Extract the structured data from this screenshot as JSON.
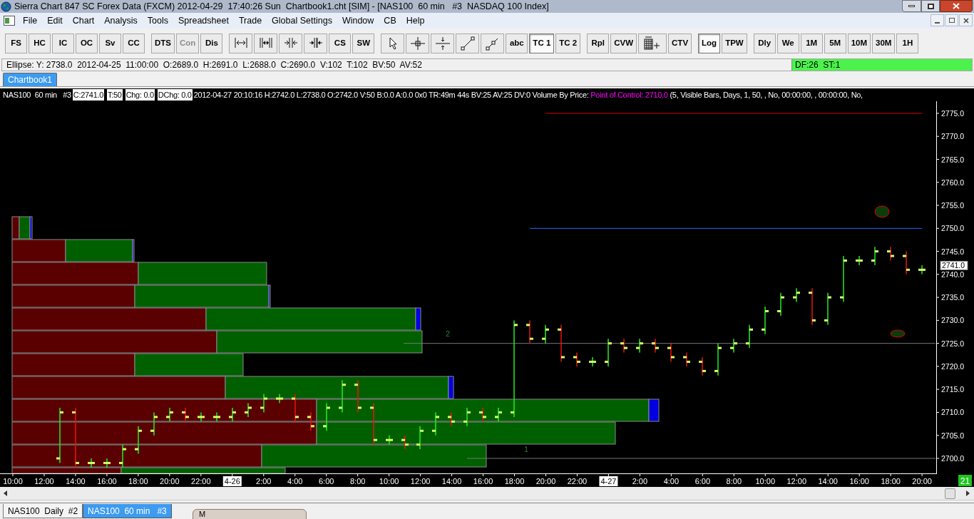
{
  "window": {
    "title": "Sierra Chart 847 SC Forex Data (FXCM) 2012-04-29  17:40:26 Sun  Chartbook1.cht [SIM] - [NAS100  60 min   #3  NASDAQ 100 Index]"
  },
  "menu": [
    "File",
    "Edit",
    "Chart",
    "Analysis",
    "Tools",
    "Spreadsheet",
    "Trade",
    "Global Settings",
    "Window",
    "CB",
    "Help"
  ],
  "toolbar": [
    [
      {
        "kind": "text",
        "label": "FS",
        "pressed": false,
        "disabled": false
      },
      {
        "kind": "text",
        "label": "HC",
        "pressed": false,
        "disabled": false
      },
      {
        "kind": "text",
        "label": "IC",
        "pressed": false,
        "disabled": false
      },
      {
        "kind": "text",
        "label": "OC",
        "pressed": false,
        "disabled": false
      },
      {
        "kind": "text",
        "label": "Sv",
        "pressed": false,
        "disabled": false
      },
      {
        "kind": "text",
        "label": "CC",
        "pressed": false,
        "disabled": false
      }
    ],
    [
      {
        "kind": "text",
        "label": "DTS",
        "pressed": false,
        "disabled": false
      },
      {
        "kind": "text",
        "label": "Con",
        "pressed": false,
        "disabled": true
      },
      {
        "kind": "text",
        "label": "Dis",
        "pressed": false,
        "disabled": false
      }
    ],
    [
      {
        "kind": "icon",
        "pressed": false,
        "disabled": false
      },
      {
        "kind": "icon",
        "pressed": false,
        "disabled": false
      },
      {
        "kind": "icon",
        "pressed": false,
        "disabled": false
      },
      {
        "kind": "icon",
        "pressed": false,
        "disabled": false
      },
      {
        "kind": "text",
        "label": "CS",
        "pressed": false,
        "disabled": false
      },
      {
        "kind": "text",
        "label": "SW",
        "pressed": false,
        "disabled": false
      }
    ],
    [
      {
        "kind": "icon",
        "pressed": false,
        "disabled": false
      },
      {
        "kind": "icon",
        "pressed": false,
        "disabled": false
      },
      {
        "kind": "icon",
        "pressed": false,
        "disabled": false
      },
      {
        "kind": "icon",
        "pressed": false,
        "disabled": false
      },
      {
        "kind": "icon",
        "pressed": false,
        "disabled": false
      },
      {
        "kind": "text",
        "label": "abc",
        "pressed": false,
        "disabled": false
      },
      {
        "kind": "text",
        "label": "TC 1",
        "pressed": true,
        "disabled": false
      },
      {
        "kind": "text",
        "label": "TC 2",
        "pressed": false,
        "disabled": false
      }
    ],
    [
      {
        "kind": "text",
        "label": "Rpl",
        "pressed": false,
        "disabled": false
      },
      {
        "kind": "text",
        "label": "CVW",
        "pressed": false,
        "disabled": false
      },
      {
        "kind": "icon",
        "pressed": false,
        "disabled": false
      },
      {
        "kind": "text",
        "label": "CTV",
        "pressed": false,
        "disabled": false
      }
    ],
    [
      {
        "kind": "text",
        "label": "Log",
        "pressed": true,
        "disabled": false
      },
      {
        "kind": "text",
        "label": "TPW",
        "pressed": false,
        "disabled": false
      }
    ],
    [
      {
        "kind": "text",
        "label": "Dly",
        "pressed": false,
        "disabled": false
      },
      {
        "kind": "text",
        "label": "We",
        "pressed": false,
        "disabled": false
      },
      {
        "kind": "text",
        "label": "1M",
        "pressed": false,
        "disabled": false
      },
      {
        "kind": "text",
        "label": "5M",
        "pressed": false,
        "disabled": false
      },
      {
        "kind": "text",
        "label": "10M",
        "pressed": false,
        "disabled": false
      },
      {
        "kind": "text",
        "label": "30M",
        "pressed": false,
        "disabled": false
      },
      {
        "kind": "text",
        "label": "1H",
        "pressed": false,
        "disabled": false
      }
    ]
  ],
  "status": {
    "text": "Ellipse: Y: 2738.0  2012-04-25  11:00:00  O:2689.0  H:2691.0  L:2688.0  C:2690.0  V:102  T:102  BV:50  AV:52",
    "feed": "DF:26  ST:1"
  },
  "chartbook_tabs": [
    {
      "label": "Chartbook1",
      "selected": true
    }
  ],
  "chart": {
    "header": [
      {
        "kind": "plain",
        "text": "NAS100  60 min   #3"
      },
      {
        "kind": "boxed",
        "text": "C:2741.0"
      },
      {
        "kind": "boxed",
        "text": "T:50"
      },
      {
        "kind": "boxed",
        "text": "Chg: 0.0"
      },
      {
        "kind": "boxed",
        "text": "DChg: 0.0"
      },
      {
        "kind": "plain",
        "text": "2012-04-27 20:10:16 H:2742.0 L:2738.0 O:2742.0 V:50 B:0.0 A:0.0 0x0 TR:49m 44s BV:25 AV:25 DV:0"
      },
      {
        "kind": "plain",
        "text": " Volume By Price: "
      },
      {
        "kind": "highlight",
        "text": "Point of Control: 2710.0"
      },
      {
        "kind": "plain",
        "text": " (5, Visible Bars, Days, 1, 50, , No, 00:00:00, , 00:00:00, No,"
      }
    ],
    "price_labels": [
      "2775.0",
      "2770.0",
      "2765.0",
      "2760.0",
      "2755.0",
      "2750.0",
      "2745.0",
      "2740.0",
      "2735.0",
      "2730.0",
      "2725.0",
      "2720.0",
      "2715.0",
      "2710.0",
      "2705.0",
      "2700.0"
    ],
    "current_price": "2741.0",
    "time_labels": [
      {
        "text": "10:00",
        "date": false
      },
      {
        "text": "12:00",
        "date": false
      },
      {
        "text": "14:00",
        "date": false
      },
      {
        "text": "16:00",
        "date": false
      },
      {
        "text": "18:00",
        "date": false
      },
      {
        "text": "20:00",
        "date": false
      },
      {
        "text": "22:00",
        "date": false
      },
      {
        "text": "4-26",
        "date": true
      },
      {
        "text": "2:00",
        "date": false
      },
      {
        "text": "4:00",
        "date": false
      },
      {
        "text": "6:00",
        "date": false
      },
      {
        "text": "8:00",
        "date": false
      },
      {
        "text": "10:00",
        "date": false
      },
      {
        "text": "12:00",
        "date": false
      },
      {
        "text": "14:00",
        "date": false
      },
      {
        "text": "16:00",
        "date": false
      },
      {
        "text": "18:00",
        "date": false
      },
      {
        "text": "20:00",
        "date": false
      },
      {
        "text": "22:00",
        "date": false
      },
      {
        "text": "4-27",
        "date": true
      },
      {
        "text": "2:00",
        "date": false
      },
      {
        "text": "4:00",
        "date": false
      },
      {
        "text": "6:00",
        "date": false
      },
      {
        "text": "8:00",
        "date": false
      },
      {
        "text": "10:00",
        "date": false
      },
      {
        "text": "12:00",
        "date": false
      },
      {
        "text": "14:00",
        "date": false
      },
      {
        "text": "16:00",
        "date": false
      },
      {
        "text": "18:00",
        "date": false
      },
      {
        "text": "20:00",
        "date": false
      }
    ],
    "drawing_labels": [
      "2",
      "1"
    ],
    "bar_badge": "21"
  },
  "chart_tabs": [
    {
      "label": "NAS100  Daily  #2",
      "selected": false
    },
    {
      "label": "NAS100  60 min   #3",
      "selected": true
    }
  ],
  "minimized_window": {
    "title": "M"
  }
}
